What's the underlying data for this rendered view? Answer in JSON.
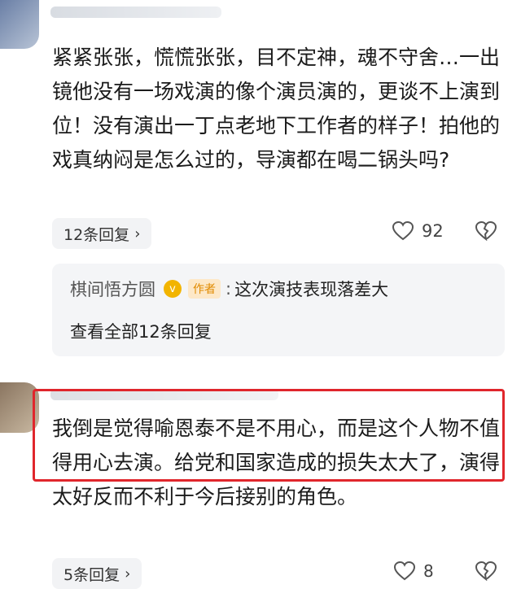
{
  "comment1": {
    "text": "紧紧张张，慌慌张张，目不定神，魂不守舍…一出镜他没有一场戏演的像个演员演的，更谈不上演到位！没有演出一丁点老地下工作者的样子！拍他的戏真纳闷是怎么过的，导演都在喝二锅头吗?",
    "replies_label": "12条回复",
    "like_count": "92"
  },
  "reply_preview": {
    "username": "棋间悟方圆",
    "verified_badge": "v",
    "author_tag": "作者",
    "separator": ":",
    "text": "这次演技表现落差大",
    "view_all_label": "查看全部12条回复"
  },
  "comment2": {
    "text": "我倒是觉得喻恩泰不是不用心，而是这个人物不值得用心去演。给党和国家造成的损失太大了，演得太好反而不利于今后接别的角色。",
    "replies_label": "5条回复",
    "like_count": "8"
  },
  "colors": {
    "highlight_border": "#e0262c",
    "author_tag_bg": "#fde8c8",
    "author_tag_text": "#e08a00",
    "verified_badge": "#f2b400"
  },
  "icons": {
    "chevron": "chevron-right-icon",
    "like": "heart-icon",
    "dislike": "broken-heart-icon"
  }
}
